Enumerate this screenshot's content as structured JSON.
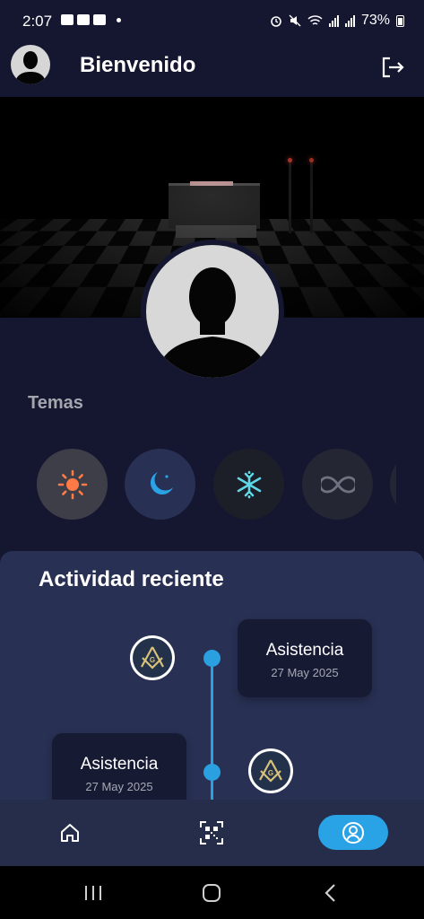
{
  "status_bar": {
    "time": "2:07",
    "battery": "73%",
    "icons": [
      "gallery-icon",
      "youtube-icon",
      "youtube-icon",
      "dot-icon",
      "alarm-icon",
      "mute-icon",
      "wifi-icon",
      "signal-icon",
      "signal-icon",
      "battery-icon"
    ]
  },
  "header": {
    "title": "Bienvenido",
    "avatar_icon": "user-silhouette-icon",
    "logout_icon": "logout-icon"
  },
  "banner": {
    "image": "lodge-altar-checkered-floor"
  },
  "themes": {
    "label": "Temas",
    "options": [
      {
        "name": "light",
        "icon": "sun-icon",
        "color": "#ff7a45",
        "bg": "#3e3e48"
      },
      {
        "name": "dark",
        "icon": "moon-icon",
        "color": "#2aa3e6",
        "bg": "#283053"
      },
      {
        "name": "snow",
        "icon": "snowflake-icon",
        "color": "#5fd7e6",
        "bg": "#1c1f27"
      },
      {
        "name": "infinity",
        "icon": "infinity-icon",
        "color": "#6f7380",
        "bg": "#242634"
      }
    ]
  },
  "activity": {
    "title": "Actividad reciente",
    "events": [
      {
        "title": "Asistencia",
        "date": "27 May 2025"
      },
      {
        "title": "Asistencia",
        "date": "27 May 2025"
      }
    ]
  },
  "bottom_nav": {
    "items": [
      {
        "name": "home",
        "icon": "home-icon"
      },
      {
        "name": "qr",
        "icon": "qr-scan-icon"
      },
      {
        "name": "profile",
        "icon": "profile-icon",
        "active": true
      }
    ]
  },
  "colors": {
    "accent": "#2aa3e6",
    "background": "#151731",
    "card": "#283053"
  }
}
